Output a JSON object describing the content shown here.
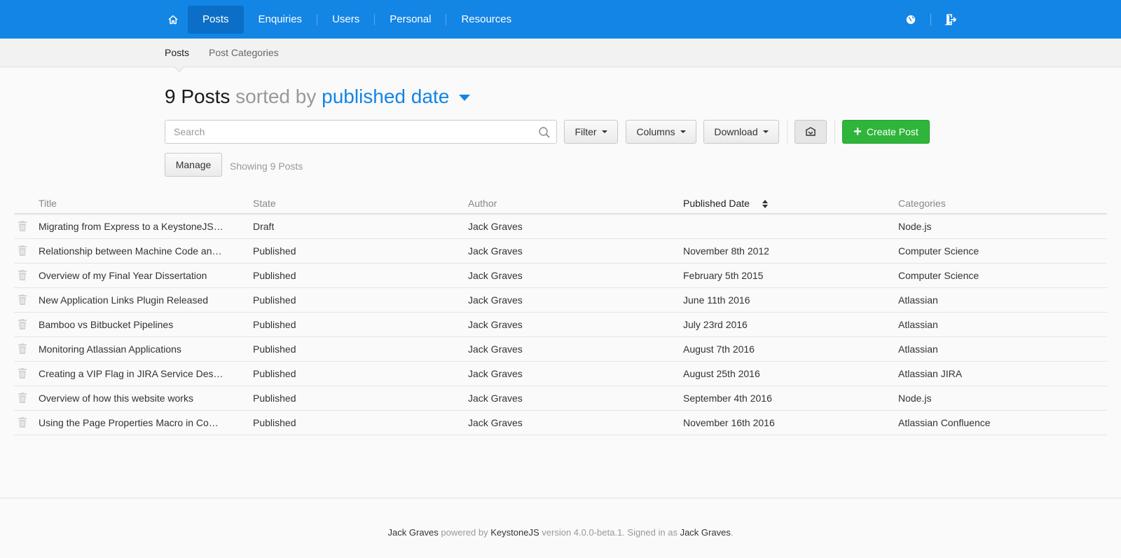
{
  "nav": {
    "items": [
      {
        "label": "Posts",
        "active": true
      },
      {
        "label": "Enquiries",
        "active": false
      },
      {
        "label": "Users",
        "active": false
      },
      {
        "label": "Personal",
        "active": false
      },
      {
        "label": "Resources",
        "active": false
      }
    ],
    "icons": [
      "home-icon",
      "globe-icon",
      "sign-out-icon"
    ]
  },
  "subnav": {
    "items": [
      {
        "label": "Posts",
        "active": true
      },
      {
        "label": "Post Categories",
        "active": false
      }
    ]
  },
  "heading": {
    "count": "9 Posts",
    "sorted_by": "sorted by",
    "sort_field": "published date"
  },
  "toolbar": {
    "search_placeholder": "Search",
    "filter_label": "Filter",
    "columns_label": "Columns",
    "download_label": "Download",
    "create_label": "Create Post",
    "manage_label": "Manage",
    "showing_label": "Showing 9 Posts"
  },
  "table": {
    "columns": [
      "Title",
      "State",
      "Author",
      "Published Date",
      "Categories"
    ],
    "sorted_column": "Published Date",
    "rows": [
      {
        "title": "Migrating from Express to a KeystoneJS…",
        "state": "Draft",
        "author": "Jack Graves",
        "date": "",
        "category": "Node.js"
      },
      {
        "title": "Relationship between Machine Code an…",
        "state": "Published",
        "author": "Jack Graves",
        "date": "November 8th 2012",
        "category": "Computer Science"
      },
      {
        "title": "Overview of my Final Year Dissertation",
        "state": "Published",
        "author": "Jack Graves",
        "date": "February 5th 2015",
        "category": "Computer Science"
      },
      {
        "title": "New Application Links Plugin Released",
        "state": "Published",
        "author": "Jack Graves",
        "date": "June 11th 2016",
        "category": "Atlassian"
      },
      {
        "title": "Bamboo vs Bitbucket Pipelines",
        "state": "Published",
        "author": "Jack Graves",
        "date": "July 23rd 2016",
        "category": "Atlassian"
      },
      {
        "title": "Monitoring Atlassian Applications",
        "state": "Published",
        "author": "Jack Graves",
        "date": "August 7th 2016",
        "category": "Atlassian"
      },
      {
        "title": "Creating a VIP Flag in JIRA Service Des…",
        "state": "Published",
        "author": "Jack Graves",
        "date": "August 25th 2016",
        "category": "Atlassian JIRA"
      },
      {
        "title": "Overview of how this website works",
        "state": "Published",
        "author": "Jack Graves",
        "date": "September 4th 2016",
        "category": "Node.js"
      },
      {
        "title": "Using the Page Properties Macro in Co…",
        "state": "Published",
        "author": "Jack Graves",
        "date": "November 16th 2016",
        "category": "Atlassian Confluence"
      }
    ]
  },
  "footer": {
    "user": "Jack Graves",
    "powered_by": "powered by",
    "product": "KeystoneJS",
    "version_text": "version 4.0.0-beta.1. Signed in as",
    "signed_in_user": "Jack Graves",
    "period": "."
  },
  "colors": {
    "brand_blue": "#1385e5",
    "create_green": "#2fb53a"
  }
}
